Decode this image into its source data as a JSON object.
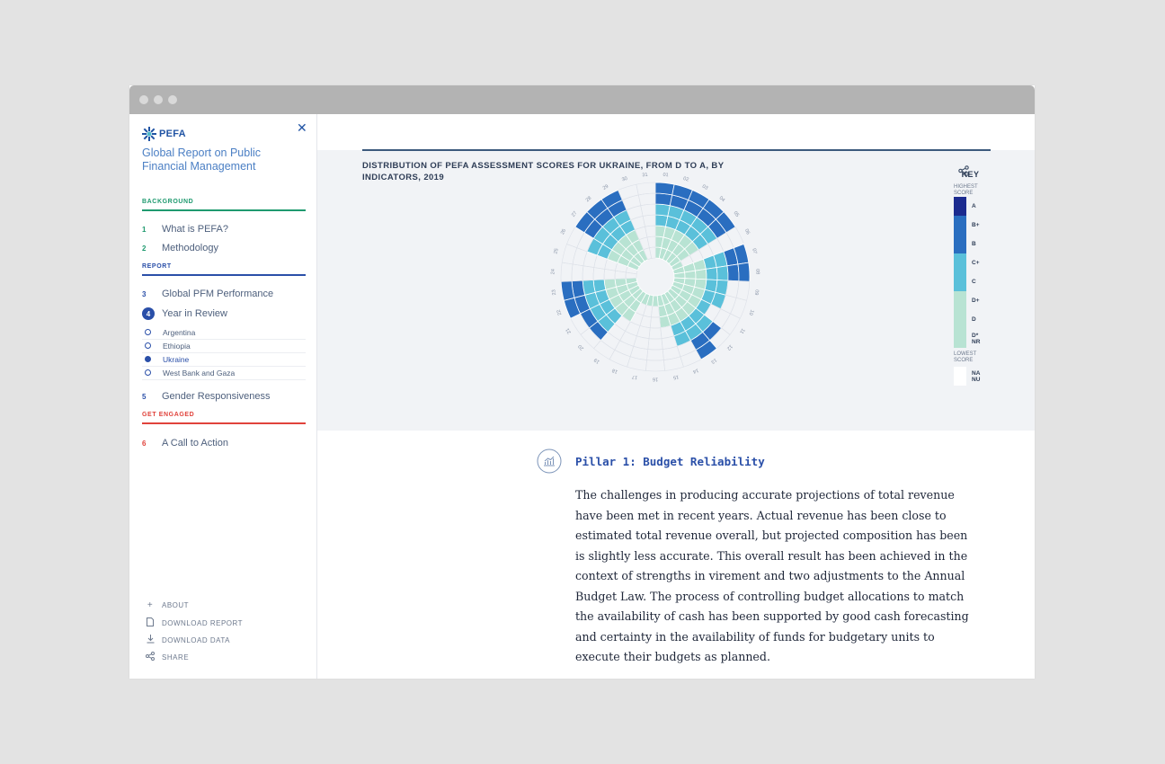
{
  "logo": {
    "text": "PEFA"
  },
  "report_title": "Global Report on Public Financial Management",
  "sidebar": {
    "sections": [
      {
        "label": "BACKGROUND",
        "color": "#1f9a6f"
      },
      {
        "label": "REPORT",
        "color": "#2a4fa8"
      },
      {
        "label": "GET ENGAGED",
        "color": "#e0423b"
      }
    ],
    "items": [
      {
        "num": "1",
        "label": "What is PEFA?"
      },
      {
        "num": "2",
        "label": "Methodology"
      },
      {
        "num": "3",
        "label": "Global PFM Performance"
      },
      {
        "num": "4",
        "label": "Year in Review"
      },
      {
        "num": "5",
        "label": "Gender Responsiveness"
      },
      {
        "num": "6",
        "label": "A Call to Action"
      }
    ],
    "subitems": [
      "Argentina",
      "Ethiopia",
      "Ukraine",
      "West Bank and Gaza"
    ],
    "active_subitem": "Ukraine",
    "footer": [
      "ABOUT",
      "DOWNLOAD REPORT",
      "DOWNLOAD DATA",
      "SHARE"
    ],
    "footer_icons": [
      "plus-icon",
      "document-icon",
      "download-icon",
      "share-icon"
    ]
  },
  "chart_data": {
    "type": "radial",
    "title": "DISTRIBUTION OF PEFA ASSESSMENT SCORES FOR UKRAINE, FROM D TO A, BY INDICATORS, 2019",
    "indicators": [
      "01",
      "02",
      "03",
      "04",
      "05",
      "06",
      "07",
      "08",
      "09",
      "10",
      "11",
      "12",
      "13",
      "14",
      "15",
      "16",
      "17",
      "18",
      "19",
      "20",
      "21",
      "22",
      "23",
      "24",
      "25",
      "26",
      "27",
      "28",
      "29",
      "30",
      "31"
    ],
    "scale_labels": [
      "D*/NR",
      "D",
      "D+",
      "C",
      "C+",
      "B",
      "B+",
      "A"
    ],
    "scores": [
      8,
      8,
      8,
      8,
      7,
      1,
      7,
      8,
      5,
      5,
      4,
      6,
      8,
      5,
      3,
      1,
      1,
      1,
      3,
      6,
      6,
      8,
      7,
      0,
      0,
      5,
      8,
      8,
      7,
      0,
      0
    ],
    "key": {
      "title": "KEY",
      "highest": "HIGHEST SCORE",
      "lowest": "LOWEST SCORE",
      "levels": [
        {
          "label": "A",
          "color": "#1c2b8f"
        },
        {
          "label": "B+",
          "color": "#2a6ec0"
        },
        {
          "label": "B",
          "color": "#2a6ec0"
        },
        {
          "label": "C+",
          "color": "#5ac0da"
        },
        {
          "label": "C",
          "color": "#5ac0da"
        },
        {
          "label": "D+",
          "color": "#b8e3d3"
        },
        {
          "label": "D",
          "color": "#b8e3d3"
        },
        {
          "label": "D* NR",
          "color": "#b8e3d3"
        },
        {
          "label": "NA NU",
          "color": "#ffffff"
        }
      ]
    }
  },
  "pillar": {
    "title": "Pillar 1: Budget Reliability",
    "body": "The challenges in producing accurate projections of total revenue have been met in recent years. Actual revenue has been close to estimated total revenue overall, but projected composition has been is slightly less accurate. This overall result has been achieved in the context of strengths in virement and two adjustments to the Annual Budget Law. The process of controlling budget allocations to match the availability of cash has been supported by good cash forecasting and certainty in the availability of funds for budgetary units to execute their budgets as planned."
  }
}
